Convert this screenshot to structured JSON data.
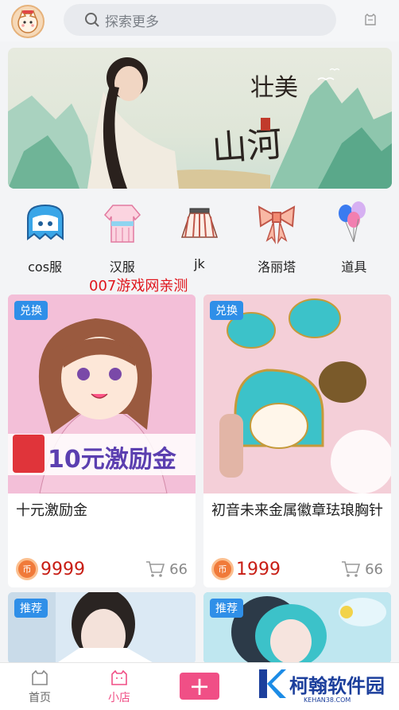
{
  "search": {
    "placeholder": "探索更多"
  },
  "categories": [
    {
      "label": "cos服",
      "icon": "ghost-icon"
    },
    {
      "label": "汉服",
      "icon": "hanfu-icon"
    },
    {
      "label": "jk",
      "icon": "skirt-icon"
    },
    {
      "label": "洛丽塔",
      "icon": "bow-icon"
    },
    {
      "label": "道具",
      "icon": "balloon-icon"
    }
  ],
  "watermark": "007游戏网亲测",
  "banner": {
    "calligraphy": "壮美山河"
  },
  "products": [
    {
      "badge": "兑换",
      "title": "十元激励金",
      "image_text": "10元激励金",
      "price": "9999",
      "cart_count": "66",
      "coin_label": "币"
    },
    {
      "badge": "兑换",
      "title": "初音未来金属徽章珐琅胸针",
      "price": "1999",
      "cart_count": "66",
      "coin_label": "币"
    },
    {
      "badge": "推荐"
    },
    {
      "badge": "推荐"
    }
  ],
  "nav": {
    "home": "首页",
    "shop": "小店",
    "add": "+"
  },
  "brand": {
    "name": "柯翰软件园",
    "sub": "KEHAN38.COM"
  },
  "colors": {
    "accent": "#f04f86",
    "price": "#c81d14",
    "badge": "#2f8fe8"
  }
}
